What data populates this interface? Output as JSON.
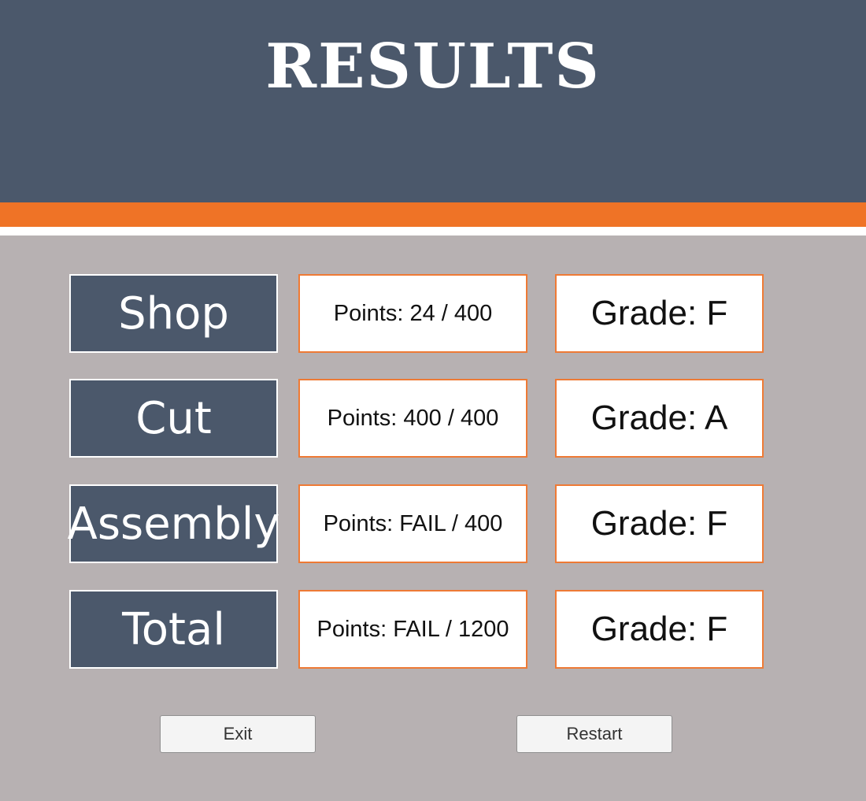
{
  "title": "RESULTS",
  "colors": {
    "header_bg": "#4b586b",
    "accent_orange": "#ef7326",
    "page_bg": "#b7b1b2",
    "cell_bg": "#ffffff"
  },
  "rows": [
    {
      "category": "Shop",
      "points": "Points: 24 / 400",
      "grade": "Grade: F"
    },
    {
      "category": "Cut",
      "points": "Points: 400 / 400",
      "grade": "Grade: A"
    },
    {
      "category": "Assembly",
      "points": "Points: FAIL / 400",
      "grade": "Grade: F"
    },
    {
      "category": "Total",
      "points": "Points: FAIL / 1200",
      "grade": "Grade: F"
    }
  ],
  "buttons": {
    "exit": "Exit",
    "restart": "Restart"
  }
}
